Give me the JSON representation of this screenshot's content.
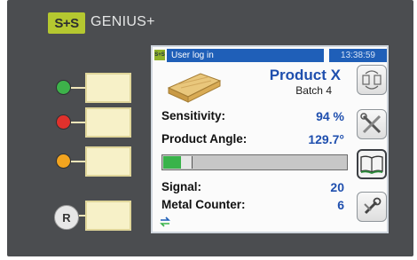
{
  "brand": {
    "logo_text": "S+S",
    "title": "GENIUS+"
  },
  "indicators": [
    {
      "name": "green",
      "color": "#3db24a"
    },
    {
      "name": "red",
      "color": "#e0312c"
    },
    {
      "name": "yellow",
      "color": "#f2a41f"
    }
  ],
  "reset": {
    "label": "R"
  },
  "screen": {
    "status": {
      "logo": "S+S",
      "user": "User log in",
      "time": "13:38:59"
    },
    "product": {
      "name": "Product X",
      "batch": "Batch 4",
      "icon": "wood-plank-icon"
    },
    "sensitivity": {
      "label": "Sensitivity:",
      "value": "94 %"
    },
    "angle": {
      "label": "Product Angle:",
      "value": "129.7°"
    },
    "signal_bar": {
      "level": 0.16
    },
    "signal": {
      "label": "Signal:",
      "value": "20"
    },
    "counter": {
      "label": "Metal Counter:",
      "value": "6"
    },
    "side_buttons": [
      "swap-icon",
      "tools-icon",
      "book-icon",
      "wrench-screwdriver-icon"
    ]
  },
  "colors": {
    "accent_blue": "#1f4fae",
    "brand_green": "#b5c830",
    "panel": "#4b4d50"
  }
}
